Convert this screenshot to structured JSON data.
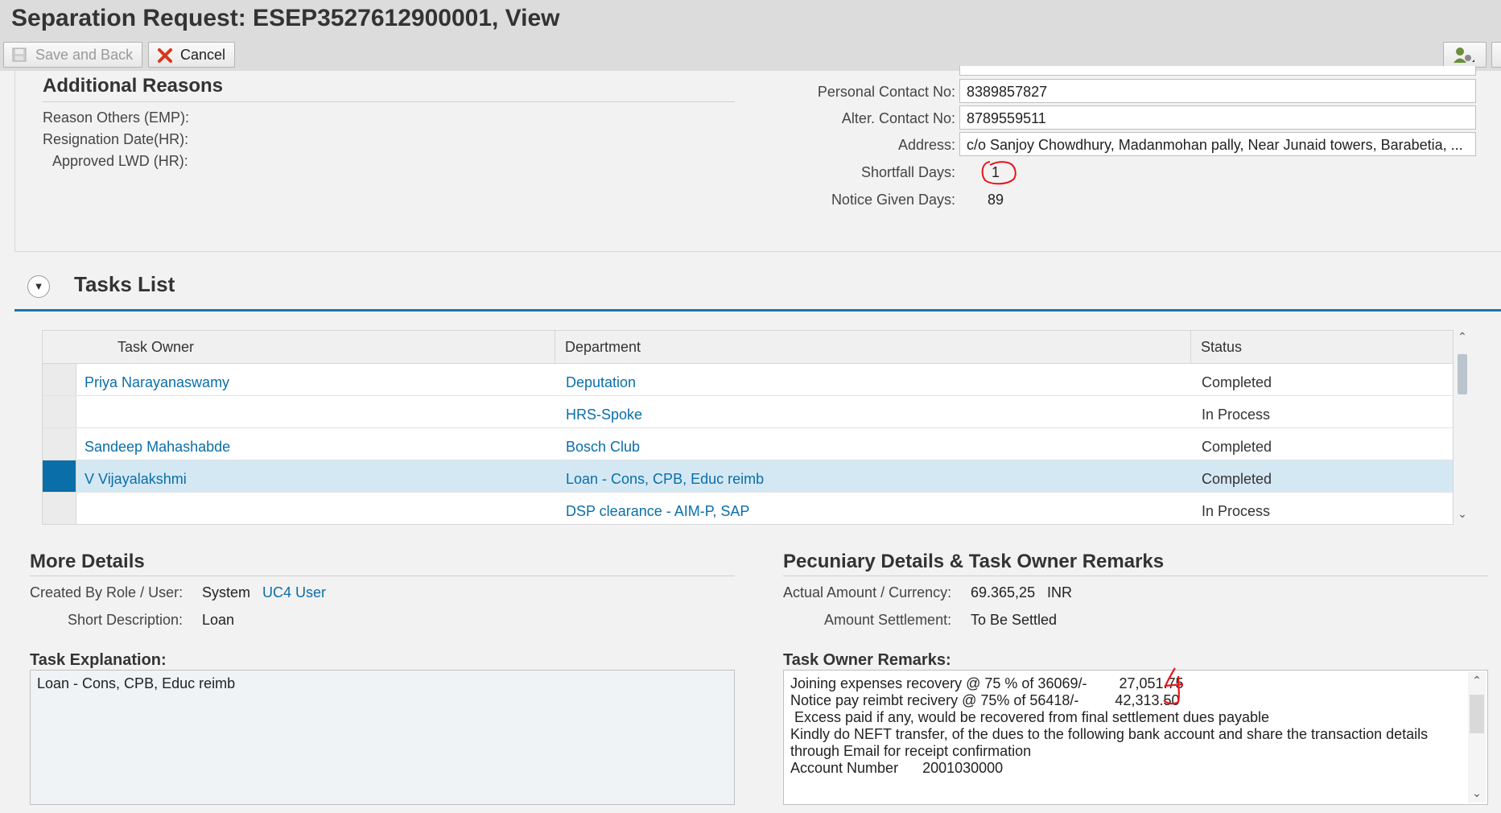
{
  "window": {
    "title": "Separation Request: ESEP3527612900001, View"
  },
  "toolbar": {
    "save_label": "Save and Back",
    "cancel_label": "Cancel"
  },
  "additional_reasons": {
    "heading": "Additional Reasons",
    "labels": [
      "Reason Others (EMP):",
      "Resignation Date(HR):",
      "Approved LWD (HR):"
    ]
  },
  "contact": {
    "personal_label": "Personal Contact No:",
    "personal_value": "8389857827",
    "alter_label": "Alter. Contact No:",
    "alter_value": "8789559511",
    "address_label": "Address:",
    "address_value": "c/o Sanjoy Chowdhury, Madanmohan pally, Near Junaid towers, Barabetia, ...",
    "shortfall_label": "Shortfall Days:",
    "shortfall_value": "1",
    "notice_label": "Notice Given Days:",
    "notice_value": "89"
  },
  "tasks": {
    "heading": "Tasks List",
    "columns": [
      "Task Owner",
      "Department",
      "Status"
    ],
    "rows": [
      {
        "owner": "Priya Narayanaswamy",
        "department": "Deputation",
        "status": "Completed"
      },
      {
        "owner": "",
        "department": "HRS-Spoke",
        "status": "In Process"
      },
      {
        "owner": "Sandeep Mahashabde",
        "department": "Bosch Club",
        "status": "Completed"
      },
      {
        "owner": "V Vijayalakshmi",
        "department": "Loan - Cons, CPB, Educ reimb",
        "status": "Completed"
      },
      {
        "owner": "",
        "department": "DSP clearance - AIM-P, SAP",
        "status": "In Process"
      }
    ],
    "selected_row": 3
  },
  "more_details": {
    "heading": "More Details",
    "created_label": "Created By Role / User:",
    "created_role": "System",
    "created_user": "UC4 User",
    "short_desc_label": "Short Description:",
    "short_desc_value": "Loan",
    "explanation_label": "Task Explanation:",
    "explanation_value": "Loan - Cons, CPB, Educ reimb"
  },
  "pecuniary": {
    "heading": "Pecuniary Details & Task Owner Remarks",
    "amount_label": "Actual Amount / Currency:",
    "amount_value": "69.365,25",
    "currency": "INR",
    "settlement_label": "Amount Settlement:",
    "settlement_value": "To Be Settled",
    "remarks_label": "Task Owner Remarks:",
    "remarks_lines": [
      "Joining expenses recovery @ 75 % of 36069/-        27,051.75",
      "Notice pay reimbt recivery @ 75% of 56418/-         42,313.50",
      " Excess paid if any, would be recovered from final settlement dues payable",
      "",
      "Kindly do NEFT transfer, of the dues to the following bank account and share the transaction details",
      "through Email for receipt confirmation",
      "",
      "Account Number      2001030000"
    ]
  },
  "colors": {
    "link": "#0a6ea8",
    "selected_row": "#d4e8f4",
    "header_bar": "#dcdcdc",
    "annotation": "#e8141c"
  },
  "icons": [
    "save-icon",
    "cancel-x-icon",
    "user-settings-icon",
    "collapse-arrow-icon",
    "scroll-up-icon",
    "scroll-down-icon"
  ]
}
